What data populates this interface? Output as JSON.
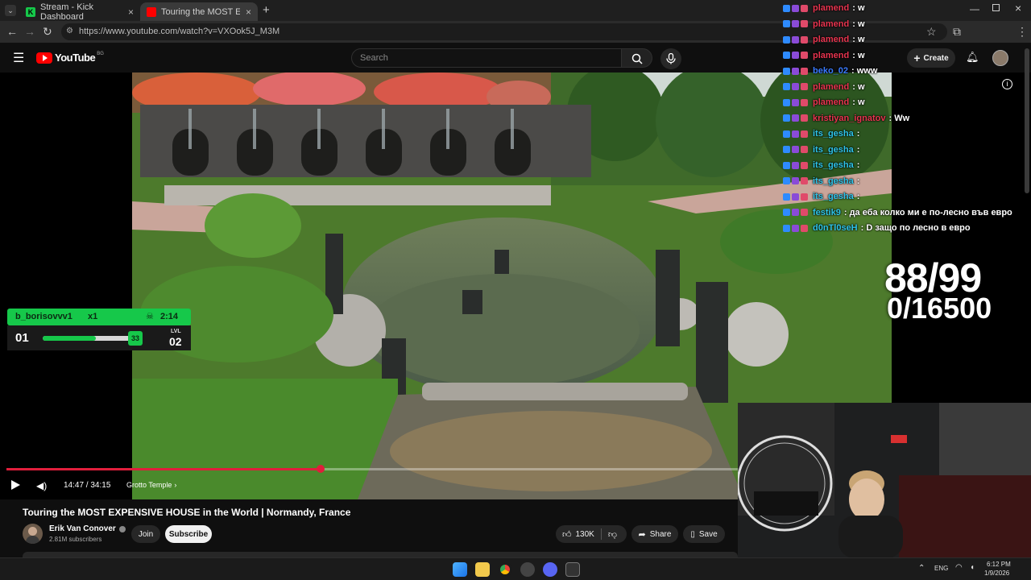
{
  "browser": {
    "tabs": [
      {
        "title": "Stream - Kick Dashboard",
        "favicon": "kick-icon"
      },
      {
        "title": "Touring the MOST EXPENSIVE H",
        "favicon": "youtube-icon"
      }
    ],
    "url": "https://www.youtube.com/watch?v=VXOok5J_M3M"
  },
  "youtube": {
    "logo_text": "YouTube",
    "region": "BG",
    "search_placeholder": "Search",
    "create_label": "Create"
  },
  "chat": [
    {
      "user": "plamend",
      "msg": ": w",
      "color": "#e8344f"
    },
    {
      "user": "plamend",
      "msg": ": w",
      "color": "#e8344f"
    },
    {
      "user": "plamend",
      "msg": ": w",
      "color": "#e8344f"
    },
    {
      "user": "plamend",
      "msg": ": w",
      "color": "#e8344f"
    },
    {
      "user": "beko_02",
      "msg": ": www",
      "color": "#3a7bff"
    },
    {
      "user": "plamend",
      "msg": ": w",
      "color": "#e8344f"
    },
    {
      "user": "plamend",
      "msg": ": w",
      "color": "#e8344f"
    },
    {
      "user": "kristiyan_ignatov",
      "msg": ": Ww",
      "color": "#e8344f"
    },
    {
      "user": "its_gesha",
      "msg": ":",
      "color": "#2ec4e8"
    },
    {
      "user": "its_gesha",
      "msg": ":",
      "color": "#2ec4e8"
    },
    {
      "user": "its_gesha",
      "msg": ":",
      "color": "#2ec4e8"
    },
    {
      "user": "its_gesha",
      "msg": ":",
      "color": "#2ec4e8"
    },
    {
      "user": "its_gesha",
      "msg": ":",
      "color": "#2ec4e8"
    },
    {
      "user": "festik9",
      "msg": ": да еба колко ми е по-лесно във евро",
      "color": "#2ec4e8"
    },
    {
      "user": "d0nTl0seH",
      "msg": ": D защо по лесно в евро",
      "color": "#2ec4e8"
    }
  ],
  "overlay": {
    "counter_main": "88/99",
    "counter_sub": "0/16500"
  },
  "level_widget": {
    "username": "b_borisovvv1",
    "multiplier": "x1",
    "timer": "2:14",
    "current_level": "01",
    "badge_value": "33",
    "lvl_label": "LVL",
    "next_level": "02",
    "progress_fraction": 0.55
  },
  "player": {
    "time": "14:47 / 34:15",
    "chapter": "Grotto Temple",
    "played_fraction": 0.43
  },
  "video": {
    "title": "Touring the MOST EXPENSIVE HOUSE in the World | Normandy, France",
    "channel": "Erik Van Conover",
    "subscribers": "2.81M subscribers",
    "join_label": "Join",
    "subscribe_label": "Subscribe",
    "likes": "130K",
    "share_label": "Share",
    "save_label": "Save"
  },
  "taskbar": {
    "language": "ENG",
    "time": "6:12 PM",
    "date": "1/9/2026"
  },
  "colors": {
    "accent_red": "#e01e3c",
    "kick_green": "#16c84a",
    "bg": "#0f0f0f"
  }
}
